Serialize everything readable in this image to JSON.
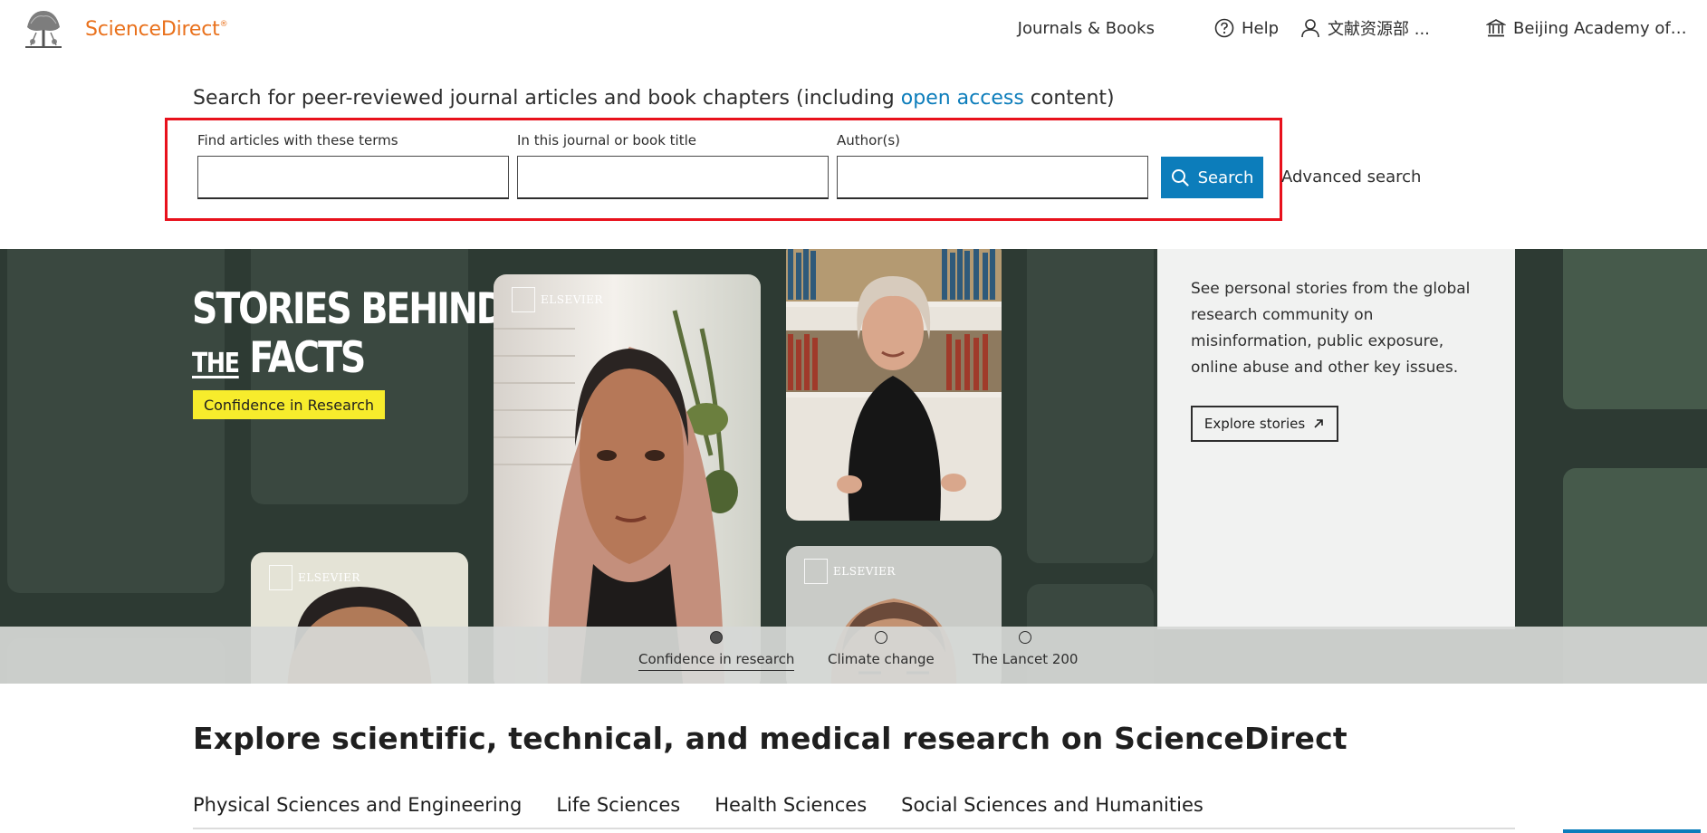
{
  "header": {
    "logo_text": "ScienceDirect",
    "logo_mark": "®",
    "nav": {
      "journals": "Journals & Books",
      "help": "Help",
      "user": "文献资源部 ...",
      "institution": "Beijing Academy of Sc..."
    }
  },
  "search": {
    "lead_before": "Search for peer-reviewed journal articles and book chapters (including ",
    "lead_link": "open access",
    "lead_after": " content)",
    "terms_label": "Find articles with these terms",
    "terms_value": "",
    "journal_label": "In this journal or book title",
    "journal_value": "",
    "authors_label": "Author(s)",
    "authors_value": "",
    "search_button": "Search",
    "advanced_link": "Advanced search"
  },
  "hero": {
    "title_line1": "STORIES BEHIND",
    "title_the": "THE",
    "title_facts": "FACTS",
    "badge": "Confidence in Research",
    "photo_brand": "ELSEVIER",
    "description": "See personal stories from the global research community on misinformation, public exposure, online abuse and other key issues.",
    "explore_button": "Explore stories",
    "carousel": [
      {
        "label": "Confidence in research",
        "active": true
      },
      {
        "label": "Climate change",
        "active": false
      },
      {
        "label": "The Lancet 200",
        "active": false
      }
    ]
  },
  "explore": {
    "title": "Explore scientific, technical, and medical research on ScienceDirect",
    "categories": [
      "Physical Sciences and Engineering",
      "Life Sciences",
      "Health Sciences",
      "Social Sciences and Humanities"
    ]
  },
  "colors": {
    "brand": "#e9711c",
    "link": "#0c7dbb",
    "highlight_box": "#e8111c",
    "hero_bg": "#2d3a33",
    "badge": "#f7ec2c"
  }
}
